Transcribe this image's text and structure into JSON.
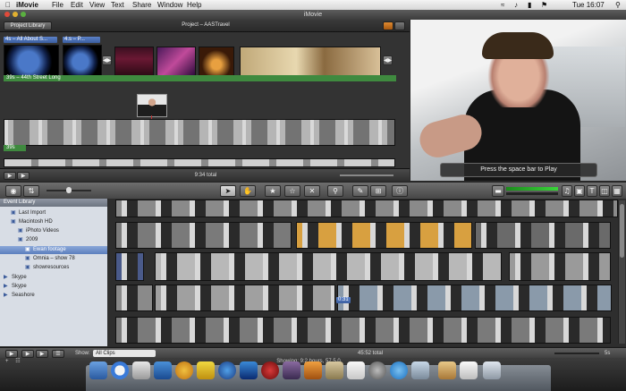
{
  "menubar": {
    "apple": "",
    "app_name": "iMovie",
    "menus": [
      "File",
      "Edit",
      "View",
      "Text",
      "Share",
      "Window",
      "Help"
    ],
    "clock": "Tue 16:07"
  },
  "window": {
    "title": "iMovie"
  },
  "project": {
    "library_button": "Project Library",
    "title": "Project – AASTravel",
    "clip_labels": [
      "4s – All About S...",
      "4.s – P..."
    ],
    "title_bar": "39s – 44th Street Long",
    "clip_duration": "39s",
    "total": "9:34 total"
  },
  "preview": {
    "tip": "Press the space bar to Play"
  },
  "toolbar": {
    "icons": [
      "camera-icon",
      "swap-icon",
      "pointer-icon",
      "crop-hand-icon",
      "favorite-star-icon",
      "unmark-star-icon",
      "reject-x-icon",
      "keyword-icon",
      "eyedropper-icon",
      "crop-icon",
      "info-icon"
    ],
    "right_icons": [
      "music-icon",
      "photo-icon",
      "text-icon",
      "transition-icon",
      "map-icon"
    ]
  },
  "library": {
    "header": "Event Library",
    "items": [
      {
        "label": "Last Import",
        "indent": 1
      },
      {
        "label": "Macintosh HD",
        "indent": 1
      },
      {
        "label": "iPhoto Videos",
        "indent": 2
      },
      {
        "label": "2009",
        "indent": 2
      },
      {
        "label": "Ewan footage",
        "indent": 3,
        "selected": true
      },
      {
        "label": "Omnia – show 78",
        "indent": 3
      },
      {
        "label": "showresources",
        "indent": 3
      },
      {
        "label": "Skype",
        "indent": 0
      },
      {
        "label": "Skype",
        "indent": 0
      },
      {
        "label": "Seashore",
        "indent": 0
      }
    ]
  },
  "events": {
    "strip_badge": "0:31"
  },
  "bottom": {
    "show_label": "Show:",
    "show_value": "All Clips",
    "total": "45:52 total",
    "center_text": "Showing: 9:2 hours, 57 5.0",
    "zoom": "5s"
  },
  "colors": {
    "accent_green": "#3f8a3f",
    "selection_blue": "#5c7fbd",
    "toolbar_gray": "#6e6e6e"
  }
}
